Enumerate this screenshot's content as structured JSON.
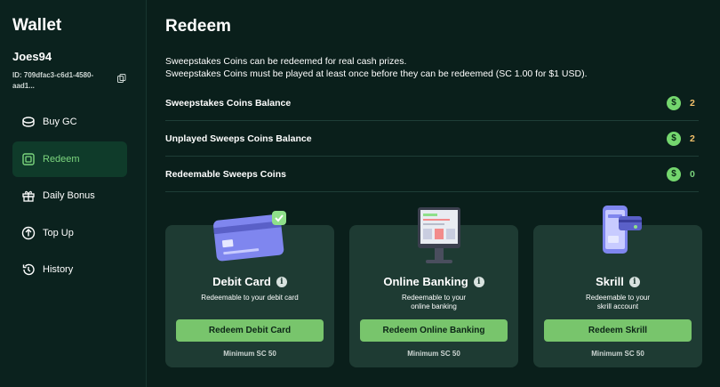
{
  "sidebar": {
    "title": "Wallet",
    "username": "Joes94",
    "user_id": "ID: 709dfac3-c6d1-4580-aad1...",
    "items": [
      {
        "label": "Buy GC",
        "icon": "coin-stack-icon",
        "active": false
      },
      {
        "label": "Redeem",
        "icon": "redeem-icon",
        "active": true
      },
      {
        "label": "Daily Bonus",
        "icon": "gift-icon",
        "active": false
      },
      {
        "label": "Top Up",
        "icon": "arrow-up-circle-icon",
        "active": false
      },
      {
        "label": "History",
        "icon": "history-icon",
        "active": false
      }
    ]
  },
  "main": {
    "title": "Redeem",
    "desc_line1": "Sweepstakes Coins can be redeemed for real cash prizes.",
    "desc_line2": "Sweepstakes Coins must be played at least once before they can be redeemed (SC 1.00 for $1 USD).",
    "balances": [
      {
        "label": "Sweepstakes Coins Balance",
        "value": "2",
        "value_color": "#f5c26b"
      },
      {
        "label": "Unplayed Sweeps Coins Balance",
        "value": "2",
        "value_color": "#f5c26b"
      },
      {
        "label": "Redeemable Sweeps Coins",
        "value": "0",
        "value_color": "#7cd67e"
      }
    ],
    "coin_symbol": "$",
    "cards": [
      {
        "title": "Debit Card",
        "sub_line1": "Redeemable to your debit card",
        "sub_line2": "",
        "button": "Redeem Debit Card",
        "min": "Minimum SC 50"
      },
      {
        "title": "Online Banking",
        "sub_line1": "Redeemable to your",
        "sub_line2": "online banking",
        "button": "Redeem Online Banking",
        "min": "Minimum SC 50"
      },
      {
        "title": "Skrill",
        "sub_line1": "Redeemable to your",
        "sub_line2": "skrill account",
        "button": "Redeem Skrill",
        "min": "Minimum SC 50"
      }
    ]
  },
  "colors": {
    "accent": "#78c56c",
    "background": "#0a1f1b",
    "card": "#1e3b33"
  }
}
